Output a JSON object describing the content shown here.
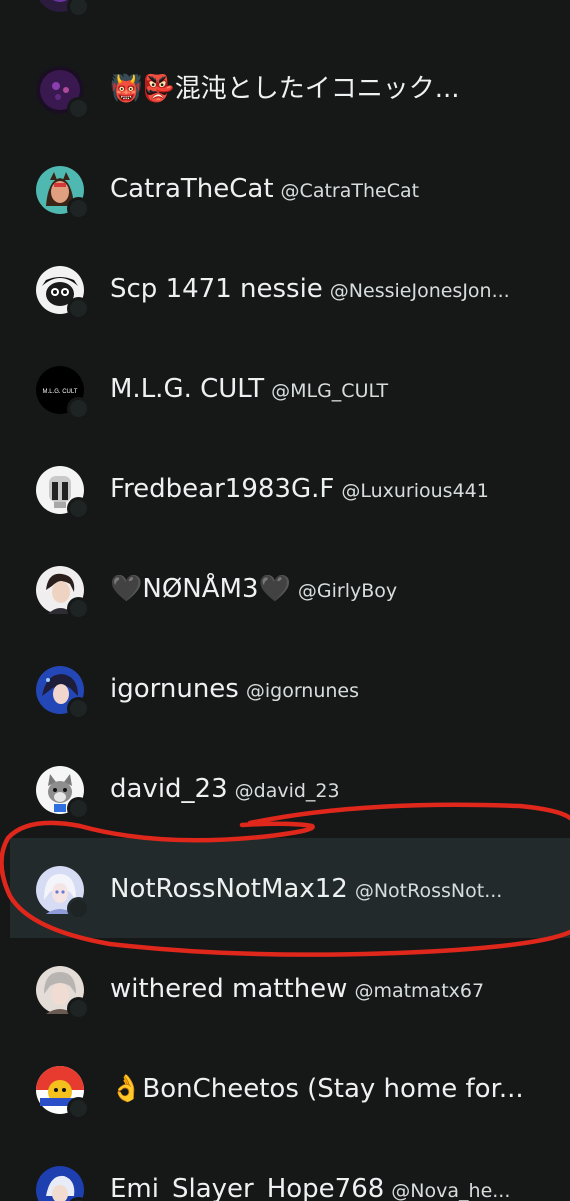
{
  "accent_color": "#e0271b",
  "users": [
    {
      "display_name": "",
      "handle": "",
      "avatar": "purple-avatar"
    },
    {
      "display_name": "👹👺混沌としたイコニック...",
      "handle": "",
      "avatar": "purple-orb-avatar"
    },
    {
      "display_name": "CatraTheCat",
      "handle": "@CatraTheCat",
      "avatar": "catra-avatar"
    },
    {
      "display_name": "Scp 1471 nessie",
      "handle": "@NessieJonesJon...",
      "avatar": "skull-avatar"
    },
    {
      "display_name": "M.L.G. CULT",
      "handle": "@MLG_CULT",
      "avatar": "mlg-cult-avatar",
      "avatar_text": "M.L.G. CULT"
    },
    {
      "display_name": "Fredbear1983G.F",
      "handle": "@Luxurious441",
      "avatar": "robot-avatar"
    },
    {
      "display_name": "🖤NØNÅM3🖤",
      "handle": "@GirlyBoy",
      "avatar": "dark-hair-avatar"
    },
    {
      "display_name": "igornunes",
      "handle": "@igornunes",
      "avatar": "blue-anime-avatar"
    },
    {
      "display_name": "david_23",
      "handle": "@david_23",
      "avatar": "wolf-avatar"
    },
    {
      "display_name": "NotRossNotMax12",
      "handle": "@NotRossNot...",
      "avatar": "white-hair-avatar",
      "highlighted": true
    },
    {
      "display_name": "withered matthew",
      "handle": "@matmatx67",
      "avatar": "grey-hair-avatar"
    },
    {
      "display_name": "👌BonCheetos (Stay home for...",
      "handle": "",
      "avatar": "cheetos-avatar"
    },
    {
      "display_name": "Emi_Slayer_Hope768",
      "handle": "@Nova_he...",
      "avatar": "blue-character-avatar"
    }
  ]
}
